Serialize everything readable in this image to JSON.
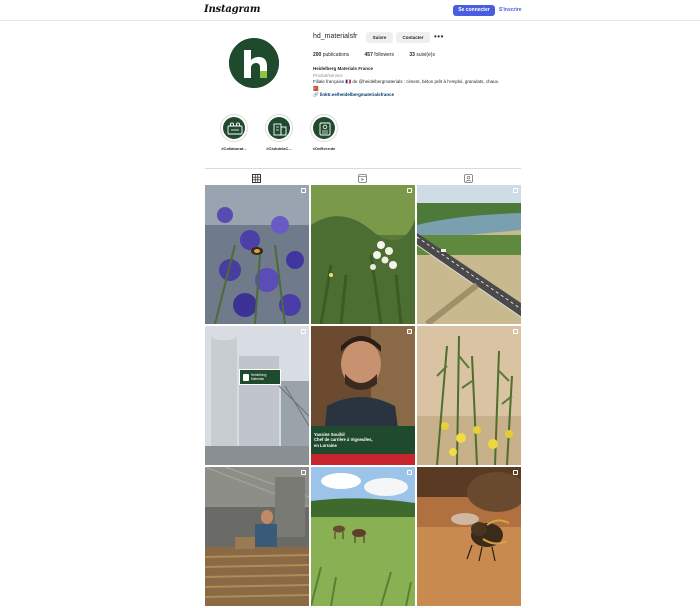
{
  "header": {
    "logo": "Instagram",
    "login_label": "Se connecter",
    "signup_label": "S'inscrire"
  },
  "profile": {
    "username": "hd_materialsfr",
    "follow_label": "Suivre",
    "contact_label": "Contacter",
    "more_label": "•••",
    "stats": [
      {
        "value": "200",
        "label": "publications"
      },
      {
        "value": "457",
        "label": "followers"
      },
      {
        "value": "33",
        "label": "suivi(e)s"
      }
    ],
    "bio": {
      "name": "Heidelberg Materials France",
      "category": "Produit/service",
      "description": "Filiale française 🇫🇷 de @heidelbergmaterials : ciment, béton prêt à l'emploi, granulats, chaux.",
      "emoji": "🧱",
      "link": "🔗 linktr.ee/heidelbergmaterialsfrance"
    }
  },
  "highlights": [
    {
      "label": "#Collaborat...",
      "icon": "team-icon"
    },
    {
      "label": "#ClubdelaC...",
      "icon": "building-icon"
    },
    {
      "label": "#OnRecrute",
      "icon": "badge-icon"
    }
  ],
  "tabs": [
    {
      "name": "posts",
      "icon": "grid-icon"
    },
    {
      "name": "reels",
      "icon": "reels-icon"
    },
    {
      "name": "tagged",
      "icon": "tagged-icon"
    }
  ],
  "posts": [
    {
      "scene": "lavender flowers with bee",
      "badge": "carousel-icon"
    },
    {
      "scene": "white wildflowers in meadow",
      "badge": "carousel-icon"
    },
    {
      "scene": "aerial view of highway bridge and river",
      "badge": "carousel-icon"
    },
    {
      "scene": "silos of concrete plant",
      "badge": "carousel-icon",
      "sign_text": "Heidelberg Materials"
    },
    {
      "scene": "portrait of quarry manager",
      "badge": "reel-icon",
      "caption": "Yassine Souihil\nChef de carrière à Vigneulles,\nen Lorraine"
    },
    {
      "scene": "yellow broom flowers",
      "badge": "carousel-icon"
    },
    {
      "scene": "worker in timber workshop",
      "badge": "carousel-icon"
    },
    {
      "scene": "goats in green field",
      "badge": "carousel-icon"
    },
    {
      "scene": "close-up of bee on wood",
      "badge": "carousel-icon"
    }
  ]
}
